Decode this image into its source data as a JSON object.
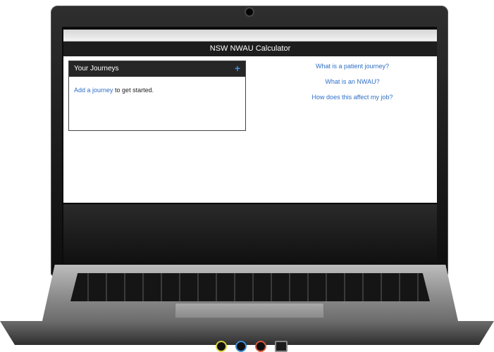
{
  "app": {
    "title": "NSW NWAU Calculator"
  },
  "journeys": {
    "heading": "Your Journeys",
    "add_icon": "plus-icon",
    "add_link": "Add a journey",
    "rest": " to get started."
  },
  "faq": [
    "What is a patient journey?",
    "What is an NWAU?",
    "How does this affect my job?"
  ],
  "colors": {
    "accent": "#2f6fc7",
    "header": "#1d1d1d"
  }
}
